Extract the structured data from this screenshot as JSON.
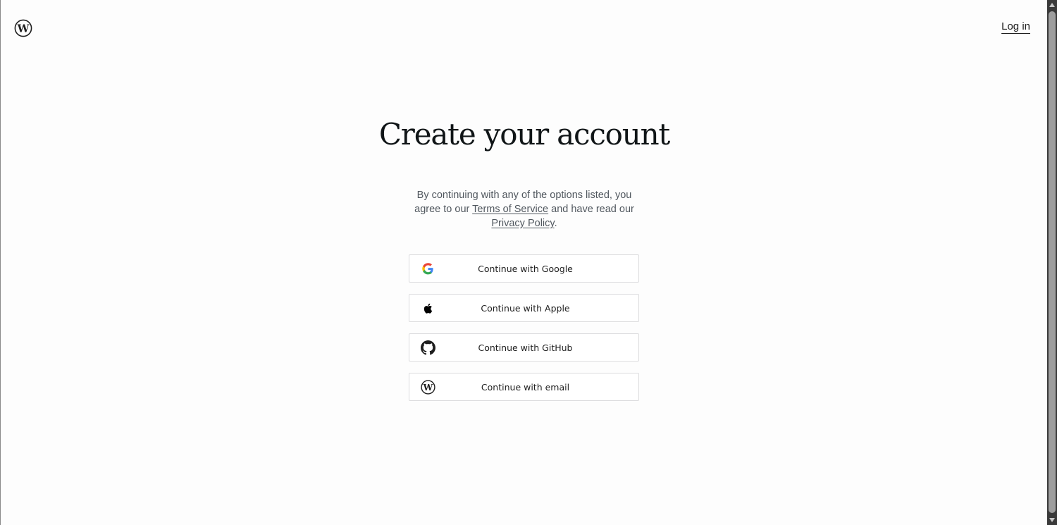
{
  "header": {
    "logo_icon": "wordpress-icon",
    "login_label": "Log in"
  },
  "main": {
    "title": "Create your account",
    "terms": {
      "prefix": "By continuing with any of the options listed, you agree to our ",
      "tos_link": "Terms of Service",
      "middle": " and have read our ",
      "privacy_link": "Privacy Policy",
      "suffix": "."
    },
    "buttons": [
      {
        "label": "Continue with Google",
        "icon": "google-icon"
      },
      {
        "label": "Continue with Apple",
        "icon": "apple-icon"
      },
      {
        "label": "Continue with GitHub",
        "icon": "github-icon"
      },
      {
        "label": "Continue with email",
        "icon": "wordpress-icon"
      }
    ]
  },
  "colors": {
    "background": "#fdfdfd",
    "text": "#1e1e1e",
    "muted_text": "#50575e",
    "button_border": "#dcdcde"
  }
}
